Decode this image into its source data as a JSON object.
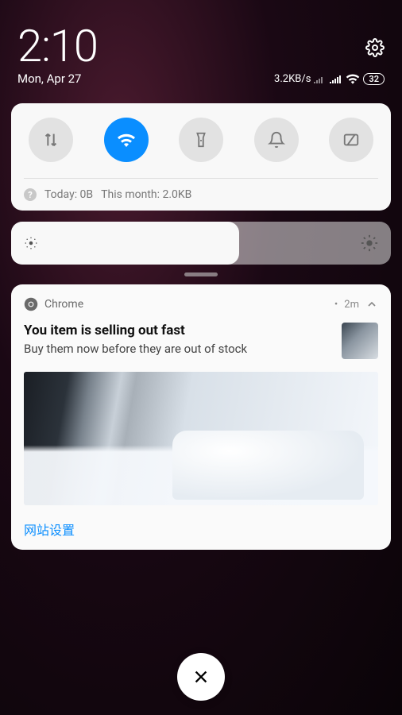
{
  "status": {
    "time": "2:10",
    "date": "Mon, Apr 27",
    "dataSpeed": "3.2KB/s",
    "battery": "32"
  },
  "quick": {
    "dataToday": "Today: 0B",
    "dataMonth": "This month: 2.0KB"
  },
  "notification": {
    "app": "Chrome",
    "ago": "2m",
    "title": "You item is selling out fast",
    "message": "Buy them now before they are out of stock",
    "action": "网站设置"
  }
}
